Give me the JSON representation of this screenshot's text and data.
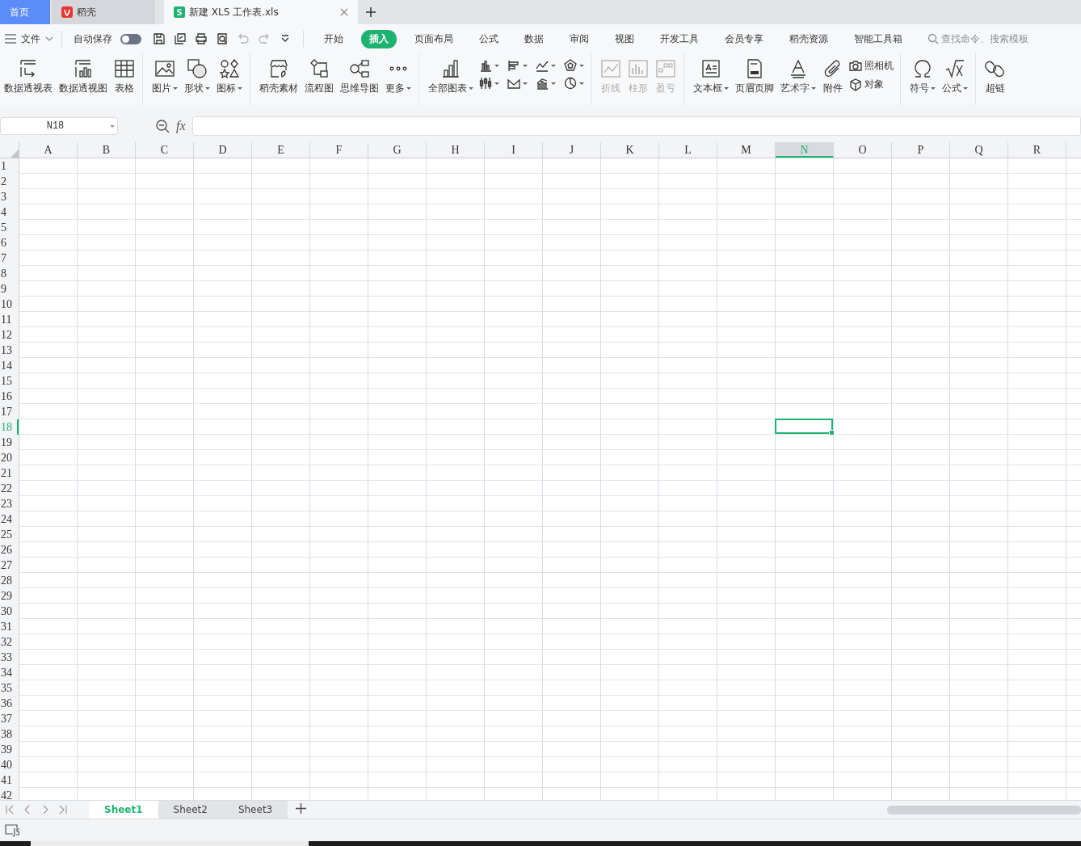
{
  "title_tabs": [
    {
      "kind": "home",
      "label": "首页",
      "selected": false
    },
    {
      "kind": "docer",
      "label": "稻壳",
      "selected": false
    },
    {
      "kind": "sheet",
      "label": "新建 XLS 工作表.xls",
      "selected": true
    }
  ],
  "menu_bar": {
    "file_label": "文件",
    "autosave": {
      "label": "自动保存",
      "on": false
    },
    "quick_tools": [
      {
        "disabled": false
      },
      {
        "disabled": false
      },
      {
        "disabled": false
      },
      {
        "disabled": false
      },
      {
        "disabled": true
      },
      {
        "disabled": true
      },
      {
        "disabled": false
      }
    ],
    "tabs": [
      {
        "label": "开始",
        "selected": false
      },
      {
        "label": "插入",
        "selected": true
      },
      {
        "label": "页面布局",
        "selected": false
      },
      {
        "label": "公式",
        "selected": false
      },
      {
        "label": "数据",
        "selected": false
      },
      {
        "label": "审阅",
        "selected": false
      },
      {
        "label": "视图",
        "selected": false
      },
      {
        "label": "开发工具",
        "selected": false
      },
      {
        "label": "会员专享",
        "selected": false
      },
      {
        "label": "稻壳资源",
        "selected": false
      },
      {
        "label": "智能工具箱",
        "selected": false
      }
    ],
    "search": {
      "placeholder": "查找命令、搜索模板"
    }
  },
  "ribbon": [
    {
      "items": [
        {
          "kind": "large",
          "label": "数据透视表",
          "caret": false,
          "disabled": false
        },
        {
          "kind": "large",
          "label": "数据透视图",
          "caret": false,
          "disabled": false
        },
        {
          "kind": "large",
          "label": "表格",
          "caret": false,
          "disabled": false
        }
      ]
    },
    {
      "items": [
        {
          "kind": "large",
          "label": "图片",
          "caret": true,
          "disabled": false
        },
        {
          "kind": "large",
          "label": "形状",
          "caret": true,
          "disabled": false
        },
        {
          "kind": "large",
          "label": "图标",
          "caret": true,
          "disabled": false
        }
      ]
    },
    {
      "items": [
        {
          "kind": "large",
          "label": "稻壳素材",
          "caret": false,
          "disabled": false
        },
        {
          "kind": "large",
          "label": "流程图",
          "caret": false,
          "disabled": false
        },
        {
          "kind": "large",
          "label": "思维导图",
          "caret": false,
          "disabled": false
        },
        {
          "kind": "large",
          "label": "更多",
          "caret": true,
          "disabled": false
        }
      ]
    },
    {
      "items": [
        {
          "kind": "large",
          "label": "全部图表",
          "caret": true,
          "disabled": false
        },
        {
          "kind": "mini",
          "caret": true,
          "disabled": false
        },
        {
          "kind": "mini",
          "caret": true,
          "disabled": false
        },
        {
          "kind": "mini",
          "caret": true,
          "disabled": false
        },
        {
          "kind": "mini",
          "caret": true,
          "disabled": false
        },
        {
          "kind": "mini",
          "caret": true,
          "disabled": false
        },
        {
          "kind": "mini",
          "caret": true,
          "disabled": false
        },
        {
          "kind": "mini",
          "caret": true,
          "disabled": false
        },
        {
          "kind": "mini",
          "caret": true,
          "disabled": false
        }
      ]
    },
    {
      "items": [
        {
          "kind": "large",
          "label": "折线",
          "caret": false,
          "disabled": true
        },
        {
          "kind": "large",
          "label": "柱形",
          "caret": false,
          "disabled": true
        },
        {
          "kind": "large",
          "label": "盈亏",
          "caret": false,
          "disabled": true
        }
      ]
    },
    {
      "items": [
        {
          "kind": "large",
          "label": "文本框",
          "caret": true,
          "disabled": false
        },
        {
          "kind": "large",
          "label": "页眉页脚",
          "caret": false,
          "disabled": false
        },
        {
          "kind": "large",
          "label": "艺术字",
          "caret": true,
          "disabled": false
        },
        {
          "kind": "large",
          "label": "附件",
          "caret": false,
          "disabled": false
        },
        {
          "kind": "small",
          "label": "照相机",
          "caret": false,
          "disabled": false
        },
        {
          "kind": "small",
          "label": "对象",
          "caret": false,
          "disabled": false
        }
      ]
    },
    {
      "items": [
        {
          "kind": "large",
          "label": "符号",
          "caret": true,
          "disabled": false
        },
        {
          "kind": "large",
          "label": "公式",
          "caret": true,
          "disabled": false
        }
      ]
    },
    {
      "items": [
        {
          "kind": "large",
          "label": "超链",
          "caret": false,
          "disabled": false
        }
      ]
    }
  ],
  "formula_bar": {
    "name_box": "N18",
    "fx_label": "fx"
  },
  "sheet": {
    "columns": [
      {
        "label": "A",
        "selected": false
      },
      {
        "label": "B",
        "selected": false
      },
      {
        "label": "C",
        "selected": false
      },
      {
        "label": "D",
        "selected": false
      },
      {
        "label": "E",
        "selected": false
      },
      {
        "label": "F",
        "selected": false
      },
      {
        "label": "G",
        "selected": false
      },
      {
        "label": "H",
        "selected": false
      },
      {
        "label": "I",
        "selected": false
      },
      {
        "label": "J",
        "selected": false
      },
      {
        "label": "K",
        "selected": false
      },
      {
        "label": "L",
        "selected": false
      },
      {
        "label": "M",
        "selected": false
      },
      {
        "label": "N",
        "selected": true
      },
      {
        "label": "O",
        "selected": false
      },
      {
        "label": "P",
        "selected": false
      },
      {
        "label": "Q",
        "selected": false
      },
      {
        "label": "R",
        "selected": false
      }
    ],
    "rows": [
      {
        "label": "1",
        "selected": false
      },
      {
        "label": "2",
        "selected": false
      },
      {
        "label": "3",
        "selected": false
      },
      {
        "label": "4",
        "selected": false
      },
      {
        "label": "5",
        "selected": false
      },
      {
        "label": "6",
        "selected": false
      },
      {
        "label": "7",
        "selected": false
      },
      {
        "label": "8",
        "selected": false
      },
      {
        "label": "9",
        "selected": false
      },
      {
        "label": "10",
        "selected": false
      },
      {
        "label": "11",
        "selected": false
      },
      {
        "label": "12",
        "selected": false
      },
      {
        "label": "13",
        "selected": false
      },
      {
        "label": "14",
        "selected": false
      },
      {
        "label": "15",
        "selected": false
      },
      {
        "label": "16",
        "selected": false
      },
      {
        "label": "17",
        "selected": false
      },
      {
        "label": "18",
        "selected": true
      },
      {
        "label": "19",
        "selected": false
      },
      {
        "label": "20",
        "selected": false
      },
      {
        "label": "21",
        "selected": false
      },
      {
        "label": "22",
        "selected": false
      },
      {
        "label": "23",
        "selected": false
      },
      {
        "label": "24",
        "selected": false
      },
      {
        "label": "25",
        "selected": false
      },
      {
        "label": "26",
        "selected": false
      },
      {
        "label": "27",
        "selected": false
      },
      {
        "label": "28",
        "selected": false
      },
      {
        "label": "29",
        "selected": false
      },
      {
        "label": "30",
        "selected": false
      },
      {
        "label": "31",
        "selected": false
      },
      {
        "label": "32",
        "selected": false
      },
      {
        "label": "33",
        "selected": false
      },
      {
        "label": "34",
        "selected": false
      },
      {
        "label": "35",
        "selected": false
      },
      {
        "label": "36",
        "selected": false
      },
      {
        "label": "37",
        "selected": false
      },
      {
        "label": "38",
        "selected": false
      },
      {
        "label": "39",
        "selected": false
      },
      {
        "label": "40",
        "selected": false
      },
      {
        "label": "41",
        "selected": false
      },
      {
        "label": "42",
        "selected": false
      }
    ]
  },
  "sheet_tabs": [
    {
      "label": "Sheet1",
      "selected": true
    },
    {
      "label": "Sheet2",
      "selected": false
    },
    {
      "label": "Sheet3",
      "selected": false
    }
  ]
}
